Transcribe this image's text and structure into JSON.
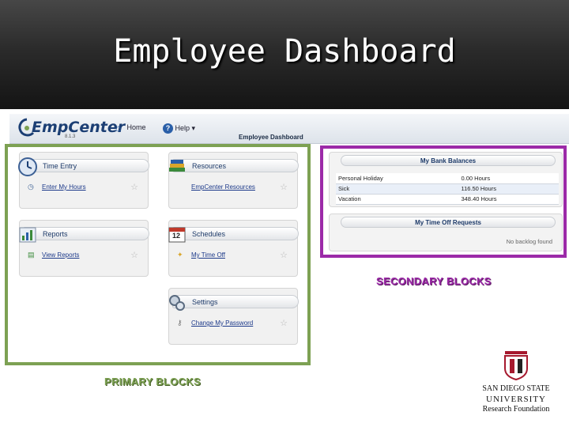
{
  "slide": {
    "title": "Employee Dashboard"
  },
  "app": {
    "logo_text": "EmpCenter",
    "logo_version": "8.1.3",
    "nav": {
      "home": "Home",
      "help": "Help",
      "help_caret": "▾"
    },
    "page_title": "Employee Dashboard"
  },
  "primary_blocks": [
    {
      "title": "Time Entry",
      "icon": "clock-icon",
      "link": "Enter My Hours",
      "link_icon": "clock-small-icon"
    },
    {
      "title": "Resources",
      "icon": "books-icon",
      "link": "EmpCenter Resources",
      "link_icon": "none"
    },
    {
      "title": "Reports",
      "icon": "chart-icon",
      "link": "View Reports",
      "link_icon": "report-small-icon"
    },
    {
      "title": "Schedules",
      "icon": "calendar-icon",
      "calendar_day": "12",
      "link": "My Time Off",
      "link_icon": "time-off-small-icon"
    },
    {
      "title": "Settings",
      "icon": "gears-icon",
      "link": "Change My Password",
      "link_icon": "key-small-icon"
    }
  ],
  "secondary_blocks": {
    "bank_balances": {
      "title": "My Bank Balances",
      "rows": [
        {
          "name": "Personal Holiday",
          "value": "0.00 Hours"
        },
        {
          "name": "Sick",
          "value": "116.50 Hours"
        },
        {
          "name": "Vacation",
          "value": "348.40 Hours"
        }
      ]
    },
    "time_off_requests": {
      "title": "My Time Off Requests",
      "empty_text": "No backlog found"
    }
  },
  "labels": {
    "secondary": "SECONDARY BLOCKS",
    "primary": "PRIMARY BLOCKS"
  },
  "sdsu_logo": {
    "line1": "SAN DIEGO STATE",
    "line2": "UNIVERSITY",
    "line3": "Research Foundation"
  },
  "colors": {
    "primary_frame": "#7da153",
    "secondary_frame": "#9c2aa8",
    "brand_blue": "#1d3a69"
  }
}
